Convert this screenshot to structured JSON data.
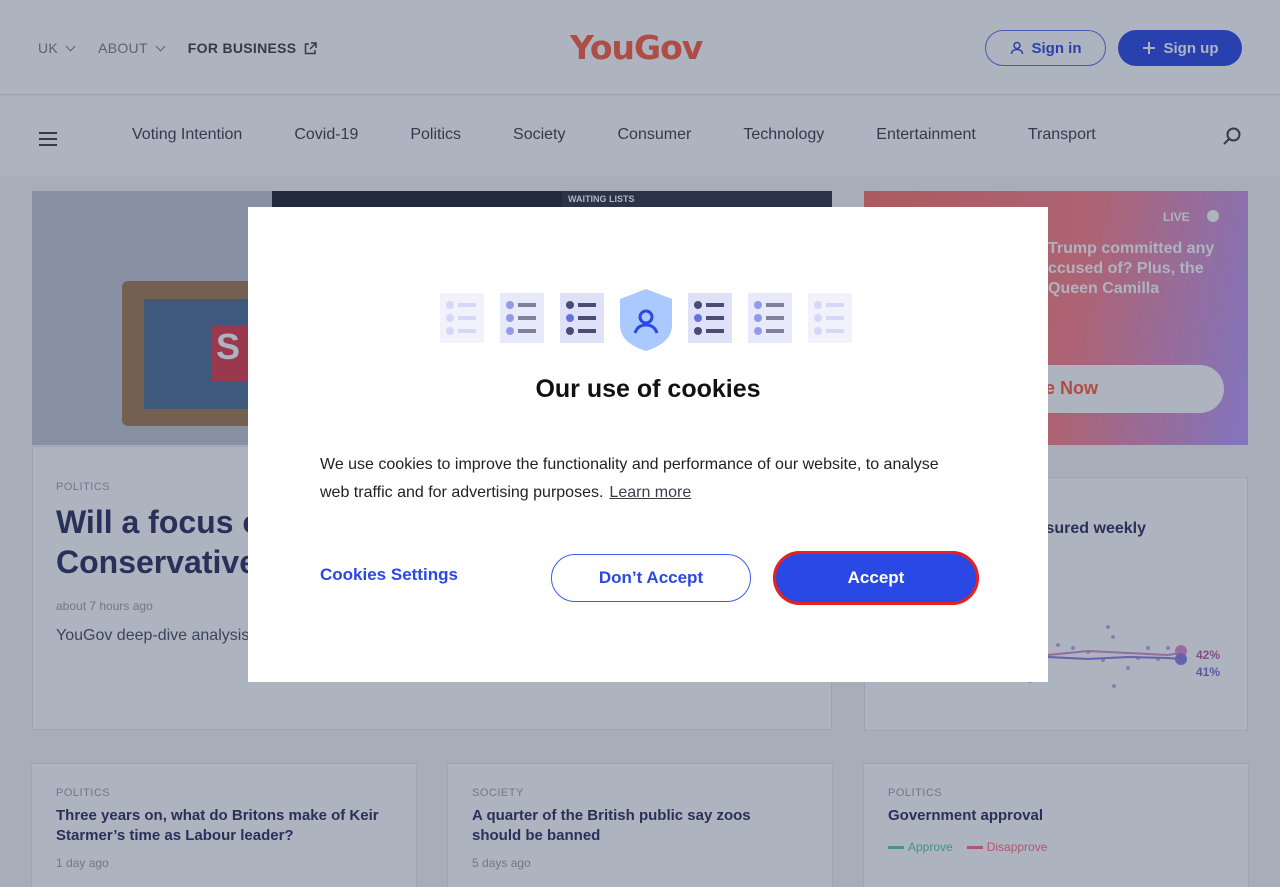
{
  "header": {
    "nav": [
      {
        "label": "UK"
      },
      {
        "label": "ABOUT"
      },
      {
        "label": "FOR BUSINESS"
      }
    ],
    "logo": "YouGov",
    "sign_in": "Sign in",
    "sign_up": "Sign up"
  },
  "categories": [
    "Voting Intention",
    "Covid-19",
    "Politics",
    "Society",
    "Consumer",
    "Technology",
    "Entertainment",
    "Transport"
  ],
  "hero": {
    "tag": "POLITICS",
    "title": "Will a focus on immigration help the Conservatives?",
    "time": "about 7 hours ago",
    "description": "YouGov deep-dive analysis... much risk and uncertain re...",
    "sign_text": "WAITING LISTS"
  },
  "live": {
    "tag": "LIVE",
    "title": "Trump committed any ccused of? Plus, the Queen Camilla",
    "button": "e Now"
  },
  "chart_card": {
    "title": "sured weekly",
    "label_a": "42%",
    "label_b": "41%"
  },
  "cards": [
    {
      "tag": "POLITICS",
      "title": "Three years on, what do Britons make of Keir Starmer’s time as Labour leader?",
      "time": "1 day ago"
    },
    {
      "tag": "SOCIETY",
      "title": "A quarter of the British public say zoos should be banned",
      "time": "5 days ago"
    },
    {
      "tag": "POLITICS",
      "title": "Government approval",
      "legend": [
        "Approve",
        "Disapprove"
      ]
    }
  ],
  "cookie_modal": {
    "title": "Our use of cookies",
    "text": "We use cookies to improve the functionality and performance of our website, to analyse web traffic and for advertising purposes.",
    "learn_more": "Learn more",
    "settings": "Cookies Settings",
    "reject": "Don’t Accept",
    "accept": "Accept"
  },
  "colors": {
    "brand": "#ff5b3a",
    "accent": "#2a48e6",
    "approve": "#4fd0a6",
    "disapprove": "#ff6f80"
  }
}
